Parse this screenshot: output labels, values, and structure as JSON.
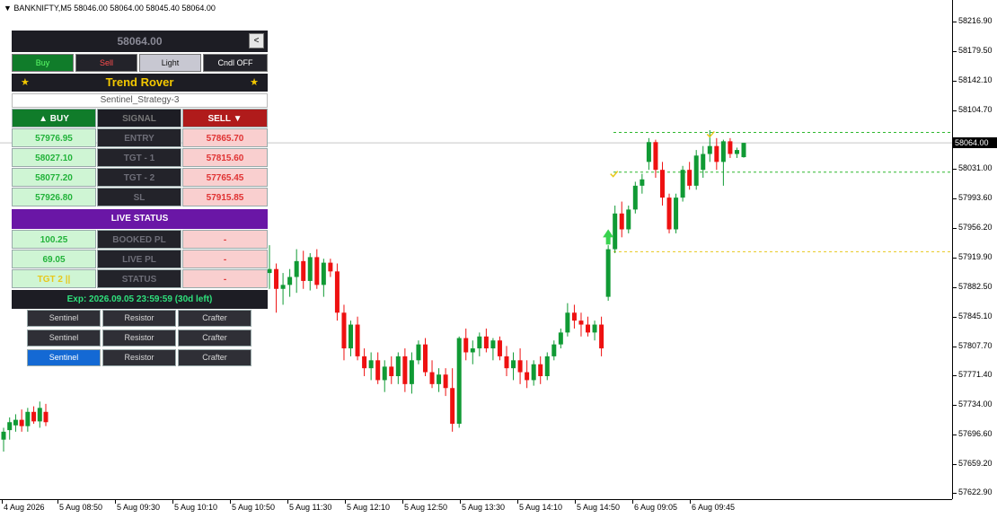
{
  "symbol_header": "BANKNIFTY,M5  58046.00 58064.00 58045.40 58064.00",
  "panel": {
    "price": "58064.00",
    "collapse_label": "<",
    "buy_label": "Buy",
    "sell_label": "Sell",
    "light_label": "Light",
    "cndl_label": "Cndl OFF",
    "title": "Trend Rover",
    "star": "★",
    "strategy": "Sentinel_Strategy-3",
    "headers": {
      "buy": "▲ BUY",
      "signal": "SIGNAL",
      "sell": "SELL ▼"
    },
    "rows": [
      {
        "buy": "57976.95",
        "label": "ENTRY",
        "sell": "57865.70"
      },
      {
        "buy": "58027.10",
        "label": "TGT - 1",
        "sell": "57815.60"
      },
      {
        "buy": "58077.20",
        "label": "TGT - 2",
        "sell": "57765.45"
      },
      {
        "buy": "57926.80",
        "label": "SL",
        "sell": "57915.85"
      }
    ],
    "live_status_title": "LIVE STATUS",
    "status_rows": [
      {
        "value": "100.25",
        "label": "BOOKED PL",
        "sell": "-",
        "color": "#22b33a"
      },
      {
        "value": "69.05",
        "label": "LIVE PL",
        "sell": "-",
        "color": "#22b33a"
      },
      {
        "value": "TGT 2 ||",
        "label": "STATUS",
        "sell": "-",
        "color": "#f3c800"
      }
    ],
    "expiry": "Exp: 2026.09.05 23:59:59 (30d left)",
    "strategy_buttons": [
      {
        "labels": [
          "Sentinel",
          "Resistor",
          "Crafter"
        ],
        "active": false
      },
      {
        "labels": [
          "Sentinel",
          "Resistor",
          "Crafter"
        ],
        "active": false
      },
      {
        "labels": [
          "Sentinel",
          "Resistor",
          "Crafter"
        ],
        "active": true
      }
    ]
  },
  "price_axis": {
    "ticks": [
      "58216.90",
      "58179.50",
      "58142.10",
      "58104.70",
      "58031.00",
      "57993.60",
      "57956.20",
      "57919.90",
      "57882.50",
      "57845.10",
      "57807.70",
      "57771.40",
      "57734.00",
      "57696.60",
      "57659.20",
      "57622.90"
    ],
    "current": "58064.00"
  },
  "time_axis": {
    "labels": [
      "4 Aug 2026",
      "5 Aug 08:50",
      "5 Aug 09:30",
      "5 Aug 10:10",
      "5 Aug 10:50",
      "5 Aug 11:30",
      "5 Aug 12:10",
      "5 Aug 12:50",
      "5 Aug 13:30",
      "5 Aug 14:10",
      "5 Aug 14:50",
      "6 Aug 09:05",
      "6 Aug 09:45"
    ]
  },
  "colors": {
    "bull": "#109a34",
    "bear": "#ee1111",
    "target_line": "#2eb82e",
    "sl_line": "#e8c81a",
    "arrow": "#39d34f"
  },
  "chart_data": {
    "type": "candlestick",
    "symbol": "BANKNIFTY",
    "timeframe": "M5",
    "candles": [
      {
        "o": 57690,
        "h": 57705,
        "l": 57675,
        "c": 57700
      },
      {
        "o": 57702,
        "h": 57718,
        "l": 57690,
        "c": 57712
      },
      {
        "o": 57708,
        "h": 57722,
        "l": 57700,
        "c": 57715
      },
      {
        "o": 57715,
        "h": 57728,
        "l": 57700,
        "c": 57707
      },
      {
        "o": 57707,
        "h": 57730,
        "l": 57700,
        "c": 57725
      },
      {
        "o": 57725,
        "h": 57732,
        "l": 57710,
        "c": 57713
      },
      {
        "o": 57713,
        "h": 57738,
        "l": 57705,
        "c": 57730
      },
      {
        "o": 57725,
        "h": 57735,
        "l": 57707,
        "c": 57712
      },
      {
        "o": 57900,
        "h": 57935,
        "l": 57880,
        "c": 57905
      },
      {
        "o": 57905,
        "h": 57912,
        "l": 57850,
        "c": 57880
      },
      {
        "o": 57880,
        "h": 57900,
        "l": 57860,
        "c": 57885
      },
      {
        "o": 57885,
        "h": 57905,
        "l": 57870,
        "c": 57895
      },
      {
        "o": 57895,
        "h": 57930,
        "l": 57875,
        "c": 57915
      },
      {
        "o": 57915,
        "h": 57928,
        "l": 57880,
        "c": 57890
      },
      {
        "o": 57890,
        "h": 57925,
        "l": 57878,
        "c": 57920
      },
      {
        "o": 57920,
        "h": 57930,
        "l": 57880,
        "c": 57885
      },
      {
        "o": 57885,
        "h": 57918,
        "l": 57870,
        "c": 57913
      },
      {
        "o": 57913,
        "h": 57918,
        "l": 57895,
        "c": 57902
      },
      {
        "o": 57902,
        "h": 57912,
        "l": 57840,
        "c": 57850
      },
      {
        "o": 57850,
        "h": 57860,
        "l": 57790,
        "c": 57805
      },
      {
        "o": 57805,
        "h": 57840,
        "l": 57795,
        "c": 57835
      },
      {
        "o": 57835,
        "h": 57845,
        "l": 57790,
        "c": 57795
      },
      {
        "o": 57795,
        "h": 57805,
        "l": 57770,
        "c": 57780
      },
      {
        "o": 57780,
        "h": 57800,
        "l": 57765,
        "c": 57790
      },
      {
        "o": 57790,
        "h": 57800,
        "l": 57760,
        "c": 57765
      },
      {
        "o": 57765,
        "h": 57790,
        "l": 57750,
        "c": 57782
      },
      {
        "o": 57782,
        "h": 57795,
        "l": 57760,
        "c": 57770
      },
      {
        "o": 57770,
        "h": 57800,
        "l": 57760,
        "c": 57795
      },
      {
        "o": 57795,
        "h": 57805,
        "l": 57750,
        "c": 57760
      },
      {
        "o": 57760,
        "h": 57800,
        "l": 57748,
        "c": 57790
      },
      {
        "o": 57790,
        "h": 57815,
        "l": 57785,
        "c": 57810
      },
      {
        "o": 57810,
        "h": 57818,
        "l": 57770,
        "c": 57775
      },
      {
        "o": 57775,
        "h": 57790,
        "l": 57755,
        "c": 57760
      },
      {
        "o": 57760,
        "h": 57780,
        "l": 57750,
        "c": 57772
      },
      {
        "o": 57772,
        "h": 57780,
        "l": 57745,
        "c": 57755
      },
      {
        "o": 57755,
        "h": 57780,
        "l": 57700,
        "c": 57710
      },
      {
        "o": 57710,
        "h": 57820,
        "l": 57705,
        "c": 57818
      },
      {
        "o": 57818,
        "h": 57830,
        "l": 57790,
        "c": 57800
      },
      {
        "o": 57800,
        "h": 57815,
        "l": 57785,
        "c": 57805
      },
      {
        "o": 57805,
        "h": 57825,
        "l": 57795,
        "c": 57820
      },
      {
        "o": 57820,
        "h": 57830,
        "l": 57800,
        "c": 57805
      },
      {
        "o": 57805,
        "h": 57818,
        "l": 57790,
        "c": 57815
      },
      {
        "o": 57815,
        "h": 57820,
        "l": 57790,
        "c": 57795
      },
      {
        "o": 57795,
        "h": 57808,
        "l": 57770,
        "c": 57780
      },
      {
        "o": 57780,
        "h": 57800,
        "l": 57765,
        "c": 57790
      },
      {
        "o": 57790,
        "h": 57805,
        "l": 57760,
        "c": 57775
      },
      {
        "o": 57775,
        "h": 57790,
        "l": 57755,
        "c": 57765
      },
      {
        "o": 57765,
        "h": 57790,
        "l": 57758,
        "c": 57785
      },
      {
        "o": 57785,
        "h": 57795,
        "l": 57760,
        "c": 57770
      },
      {
        "o": 57770,
        "h": 57800,
        "l": 57765,
        "c": 57795
      },
      {
        "o": 57795,
        "h": 57815,
        "l": 57790,
        "c": 57810
      },
      {
        "o": 57810,
        "h": 57830,
        "l": 57805,
        "c": 57825
      },
      {
        "o": 57825,
        "h": 57862,
        "l": 57820,
        "c": 57850
      },
      {
        "o": 57850,
        "h": 57860,
        "l": 57830,
        "c": 57840
      },
      {
        "o": 57840,
        "h": 57850,
        "l": 57820,
        "c": 57835
      },
      {
        "o": 57835,
        "h": 57845,
        "l": 57820,
        "c": 57825
      },
      {
        "o": 57825,
        "h": 57840,
        "l": 57815,
        "c": 57835
      },
      {
        "o": 57835,
        "h": 57845,
        "l": 57795,
        "c": 57805
      },
      {
        "o": 57870,
        "h": 57935,
        "l": 57865,
        "c": 57930
      },
      {
        "o": 57930,
        "h": 57985,
        "l": 57925,
        "c": 57975
      },
      {
        "o": 57975,
        "h": 57990,
        "l": 57945,
        "c": 57955
      },
      {
        "o": 57955,
        "h": 57985,
        "l": 57950,
        "c": 57980
      },
      {
        "o": 57980,
        "h": 58015,
        "l": 57975,
        "c": 58010
      },
      {
        "o": 58010,
        "h": 58025,
        "l": 58000,
        "c": 58018
      },
      {
        "o": 58040,
        "h": 58070,
        "l": 58030,
        "c": 58065
      },
      {
        "o": 58065,
        "h": 58068,
        "l": 58020,
        "c": 58030
      },
      {
        "o": 58030,
        "h": 58040,
        "l": 57985,
        "c": 57995
      },
      {
        "o": 57995,
        "h": 58000,
        "l": 57950,
        "c": 57955
      },
      {
        "o": 57955,
        "h": 58000,
        "l": 57950,
        "c": 57995
      },
      {
        "o": 57995,
        "h": 58035,
        "l": 57990,
        "c": 58030
      },
      {
        "o": 58030,
        "h": 58040,
        "l": 58005,
        "c": 58010
      },
      {
        "o": 58010,
        "h": 58055,
        "l": 58005,
        "c": 58048
      },
      {
        "o": 58030,
        "h": 58060,
        "l": 58020,
        "c": 58050
      },
      {
        "o": 58050,
        "h": 58080,
        "l": 58040,
        "c": 58060
      },
      {
        "o": 58060,
        "h": 58070,
        "l": 58030,
        "c": 58040
      },
      {
        "o": 58040,
        "h": 58068,
        "l": 58010,
        "c": 58066
      },
      {
        "o": 58066,
        "h": 58070,
        "l": 58045,
        "c": 58050
      },
      {
        "o": 58050,
        "h": 58058,
        "l": 58045,
        "c": 58055
      },
      {
        "o": 58046,
        "h": 58064,
        "l": 58045.4,
        "c": 58064
      }
    ],
    "horizontal_lines": [
      {
        "price": 58077.2,
        "label": "TGT - 2 buy"
      },
      {
        "price": 58027.1,
        "label": "TGT - 1 buy"
      },
      {
        "price": 57926.8,
        "label": "SL buy"
      }
    ],
    "current_price": 58064.0,
    "ylim": [
      57615,
      58235
    ]
  }
}
